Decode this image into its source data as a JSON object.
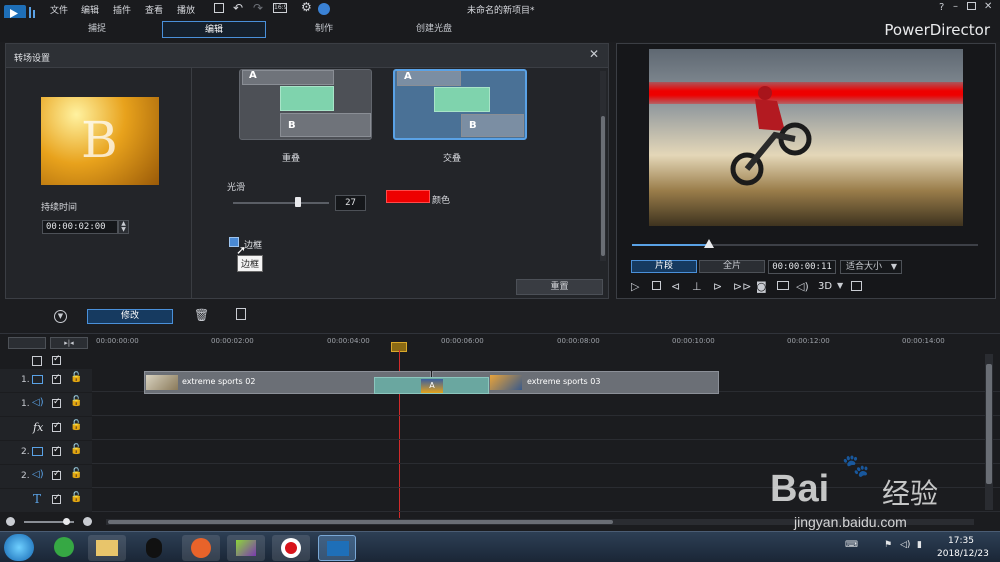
{
  "titlebar": {
    "menus": [
      "文件",
      "编辑",
      "插件",
      "查看",
      "播放"
    ],
    "project_title": "未命名的新项目*",
    "help": "?"
  },
  "modes": [
    "捕捉",
    "编辑",
    "制作",
    "创建光盘"
  ],
  "brand": "PowerDirector",
  "panel": {
    "title": "转场设置",
    "thumb_letter": "B",
    "duration_label": "持续时间",
    "duration_value": "00:00:02:00",
    "overlap_label": "重叠",
    "cross_label": "交叠",
    "tile_a": "A",
    "tile_b": "B",
    "smooth_label": "光滑",
    "smooth_value": "27",
    "color_label": "颜色",
    "color_value": "#ee0000",
    "border_label": "边框",
    "border_tooltip": "边框",
    "border_checked": true,
    "reset_label": "重置"
  },
  "preview": {
    "clip_tab": "片段",
    "movie_tab": "全片",
    "timecode": "00:00:00:11",
    "fit_label": "适合大小",
    "mode_3d": "3D"
  },
  "toolbar": {
    "modify_label": "修改"
  },
  "timeline": {
    "ticks": [
      "00:00:00:00",
      "00:00:02:00",
      "00:00:04:00",
      "00:00:06:00",
      "00:00:08:00",
      "00:00:10:00",
      "00:00:12:00",
      "00:00:14:00"
    ],
    "tracks": [
      "1.",
      "1.",
      "fx",
      "2.",
      "2.",
      "T"
    ],
    "clip1": "extreme sports 02",
    "clip2": "extreme sports 03"
  },
  "taskbar": {
    "time": "17:35",
    "date": "2018/12/23"
  },
  "watermark": {
    "brand": "Bai",
    "brand2": "经验",
    "url": "jingyan.baidu.com"
  }
}
